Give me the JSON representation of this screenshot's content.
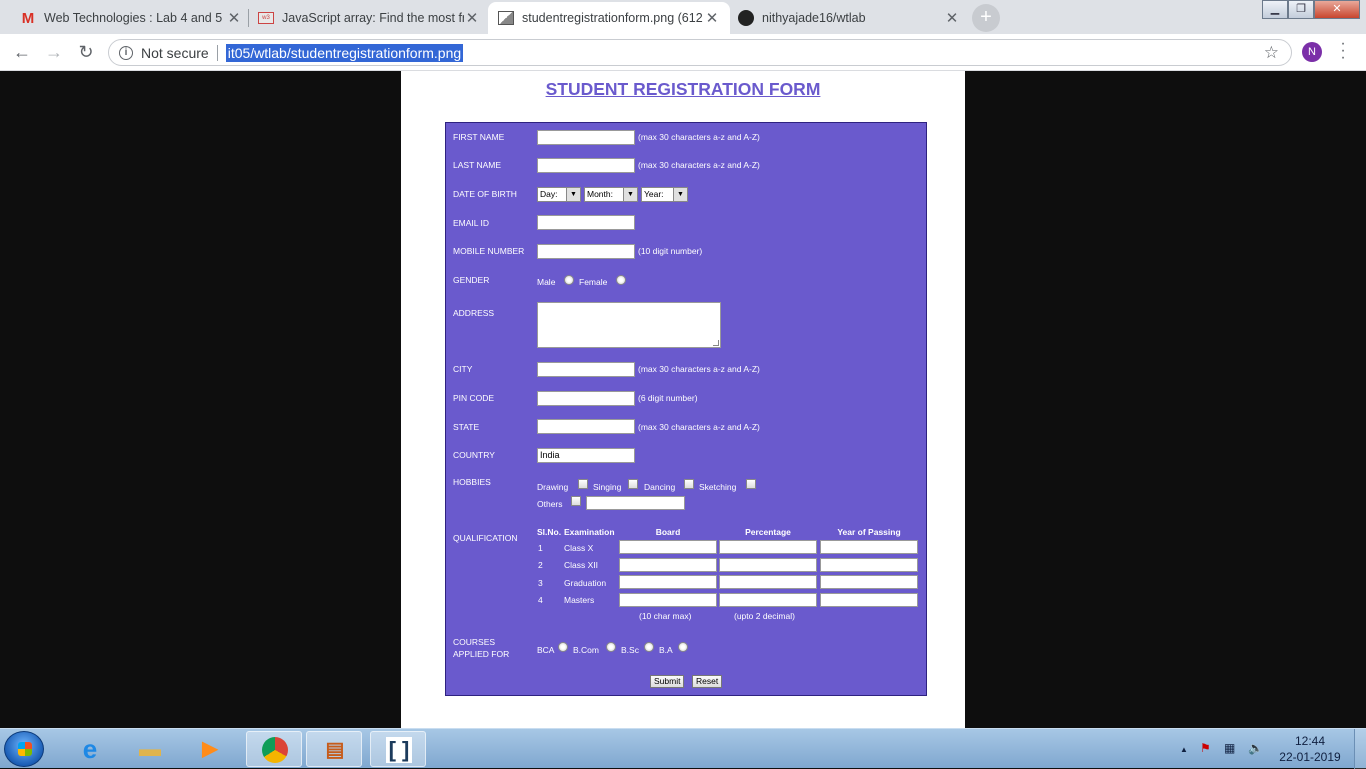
{
  "browser": {
    "tabs": [
      {
        "title": "Web Technologies : Lab 4 and 5 (",
        "favicon": "gmail-icon",
        "active": false
      },
      {
        "title": "JavaScript array: Find the most fre",
        "favicon": "w3resource-icon",
        "active": false
      },
      {
        "title": "studentregistrationform.png (612",
        "favicon": "image-icon",
        "active": true
      },
      {
        "title": "nithyajade16/wtlab",
        "favicon": "github-icon",
        "active": false
      }
    ],
    "tab_close_glyph": "✕",
    "new_tab_glyph": "+",
    "security_label": "Not secure",
    "url": "it05/wtlab/studentregistrationform.png",
    "profile_initial": "N"
  },
  "form": {
    "title": "STUDENT REGISTRATION FORM",
    "first_name": {
      "label": "FIRST NAME",
      "hint": "(max 30 characters a-z and A-Z)"
    },
    "last_name": {
      "label": "LAST NAME",
      "hint": "(max 30 characters a-z and A-Z)"
    },
    "dob": {
      "label": "DATE OF BIRTH",
      "day": "Day:",
      "month": "Month:",
      "year": "Year:"
    },
    "email": {
      "label": "EMAIL ID"
    },
    "mobile": {
      "label": "MOBILE NUMBER",
      "hint": "(10 digit number)"
    },
    "gender": {
      "label": "GENDER",
      "male": "Male",
      "female": "Female"
    },
    "address": {
      "label": "ADDRESS"
    },
    "city": {
      "label": "CITY",
      "hint": "(max 30 characters a-z and A-Z)"
    },
    "pin": {
      "label": "PIN CODE",
      "hint": "(6 digit number)"
    },
    "state": {
      "label": "STATE",
      "hint": "(max 30 characters a-z and A-Z)"
    },
    "country": {
      "label": "COUNTRY",
      "value": "India"
    },
    "hobbies": {
      "label": "HOBBIES",
      "items": [
        "Drawing",
        "Singing",
        "Dancing",
        "Sketching"
      ],
      "others": "Others"
    },
    "qualification": {
      "label": "QUALIFICATION",
      "headers": [
        "Sl.No.",
        "Examination",
        "Board",
        "Percentage",
        "Year of Passing"
      ],
      "rows": [
        {
          "no": "1",
          "exam": "Class X"
        },
        {
          "no": "2",
          "exam": "Class XII"
        },
        {
          "no": "3",
          "exam": "Graduation"
        },
        {
          "no": "4",
          "exam": "Masters"
        }
      ],
      "board_hint": "(10 char max)",
      "percent_hint": "(upto 2 decimal)"
    },
    "courses": {
      "label_line1": "COURSES",
      "label_line2": "APPLIED FOR",
      "options": [
        "BCA",
        "B.Com",
        "B.Sc",
        "B.A"
      ]
    },
    "submit": "Submit",
    "reset": "Reset"
  },
  "taskbar": {
    "time": "12:44",
    "date": "22-01-2019"
  }
}
